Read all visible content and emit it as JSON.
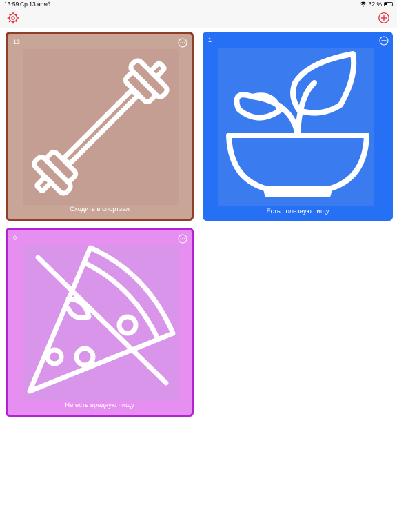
{
  "status_bar": {
    "time": "13:59",
    "date": "Ср 13 нояб.",
    "battery": "32 %"
  },
  "nav": {
    "left_icon": "gear-icon",
    "right_icon": "plus-circle-icon",
    "accent_color": "#e0333f"
  },
  "habits": [
    {
      "count": "13",
      "label": "Сходить в спортзал",
      "icon": "dumbbell-icon",
      "color": "#c8a596",
      "border_color": "#8f3f27"
    },
    {
      "count": "1",
      "label": "Есть полезную пищу",
      "icon": "salad-bowl-icon",
      "color": "#2670f5",
      "border_color": ""
    },
    {
      "count": "0",
      "label": "Не есть вредную пищу",
      "icon": "no-pizza-icon",
      "color": "#e68ff0",
      "border_color": "#b222d1"
    }
  ]
}
